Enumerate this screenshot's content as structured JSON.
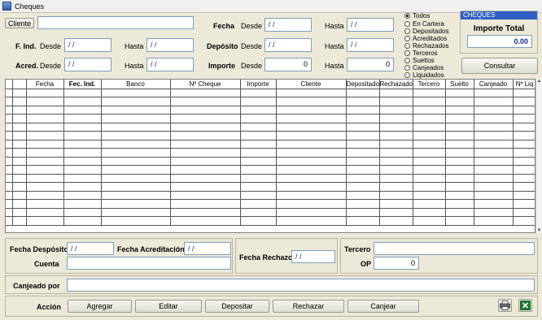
{
  "window": {
    "title": "Cheques"
  },
  "filters": {
    "cliente_button": "Cliente",
    "cliente_value": "",
    "fecha_label": "Fecha",
    "fecha_desde_label": "Desde",
    "fecha_desde_value": " /  /",
    "fecha_hasta_label": "Hasta",
    "fecha_hasta_value": " /  /",
    "find_label": "F. Ind.",
    "find_desde_label": "Desde",
    "find_desde_value": " /  /",
    "find_hasta_label": "Hasta",
    "find_hasta_value": " /  /",
    "deposito_label": "Depósito",
    "deposito_desde_label": "Desde",
    "deposito_desde_value": " /  /",
    "deposito_hasta_label": "Hasta",
    "deposito_hasta_value": " /  /",
    "acred_label": "Acred.",
    "acred_desde_label": "Desde",
    "acred_desde_value": " /  /",
    "acred_hasta_label": "Hasta",
    "acred_hasta_value": " /  /",
    "importe_label": "Importe",
    "importe_desde_label": "Desde",
    "importe_desde_value": "0",
    "importe_hasta_label": "Hasta",
    "importe_hasta_value": "0"
  },
  "status_options": [
    "Todos",
    "En Cartera",
    "Depositados",
    "Acreditados",
    "Rechazados",
    "Terceros",
    "Sueltos",
    "Canjeados",
    "Liquidados"
  ],
  "status_selected": "Todos",
  "summary": {
    "header": "CHEQUES",
    "importe_total_label": "Importe Total",
    "importe_total_value": "0.00",
    "consultar_button": "Consultar"
  },
  "table": {
    "columns": [
      "",
      "Fecha",
      "Fec. Ind.",
      "Banco",
      "Nº Cheque",
      "Importe",
      "Cliente",
      "Depositado",
      "Rechazado",
      "Tercero",
      "Suelto",
      "Canjeado",
      "Nº Liq"
    ],
    "bold_columns": [
      "Fec. Ind."
    ],
    "row_count": 16
  },
  "details": {
    "fecha_deposito_label": "Fecha Despósito",
    "fecha_deposito_value": " /  /",
    "fecha_acreditacion_label": "Fecha Acreditación",
    "fecha_acreditacion_value": " /  /",
    "cuenta_label": "Cuenta",
    "cuenta_value": "",
    "fecha_rechazo_label": "Fecha Rechazo",
    "fecha_rechazo_value": " /  /",
    "tercero_label": "Tercero",
    "tercero_value": "",
    "op_label": "OP",
    "op_value": "0",
    "canjeado_por_label": "Canjeado por",
    "canjeado_por_value": ""
  },
  "actions": {
    "label": "Acción",
    "agregar": "Agregar",
    "editar": "Editar",
    "depositar": "Depositar",
    "rechazar": "Rechazar",
    "canjear": "Canjear",
    "print_icon": "printer-icon",
    "excel_icon": "excel-icon"
  },
  "colors": {
    "accent_header": "#2f5fc4",
    "total_value": "#1b2a8c",
    "excel_green": "#1e7a2e"
  }
}
